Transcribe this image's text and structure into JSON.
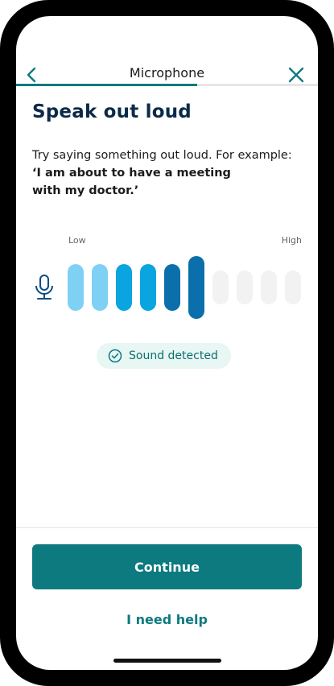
{
  "header": {
    "title": "Microphone",
    "back_icon": "chevron-left-icon",
    "close_icon": "close-icon",
    "progress": 0.6
  },
  "main": {
    "title": "Speak out loud",
    "instruction": "Try saying something out loud. For example:",
    "example": "‘I am about to have a meeting with my doctor.’",
    "level_low_label": "Low",
    "level_high_label": "High",
    "mic_icon": "microphone-icon",
    "levels": [
      {
        "active": true,
        "color": "#7fd0f5",
        "height": 58
      },
      {
        "active": true,
        "color": "#7fd0f5",
        "height": 58
      },
      {
        "active": true,
        "color": "#0aa4e0",
        "height": 58
      },
      {
        "active": true,
        "color": "#0aa4e0",
        "height": 58
      },
      {
        "active": true,
        "color": "#0b6fab",
        "height": 58
      },
      {
        "active": true,
        "color": "#0b6fab",
        "height": 78
      },
      {
        "active": false,
        "color": "#f2f2f2",
        "height": 42
      },
      {
        "active": false,
        "color": "#f2f2f2",
        "height": 42
      },
      {
        "active": false,
        "color": "#f2f2f2",
        "height": 42
      },
      {
        "active": false,
        "color": "#f2f2f2",
        "height": 42
      }
    ],
    "status_badge": "Sound detected",
    "status_icon": "check-circle-icon"
  },
  "footer": {
    "continue_label": "Continue",
    "help_label": "I need help"
  },
  "colors": {
    "accent": "#0d7a80",
    "title": "#0b2a4a"
  }
}
